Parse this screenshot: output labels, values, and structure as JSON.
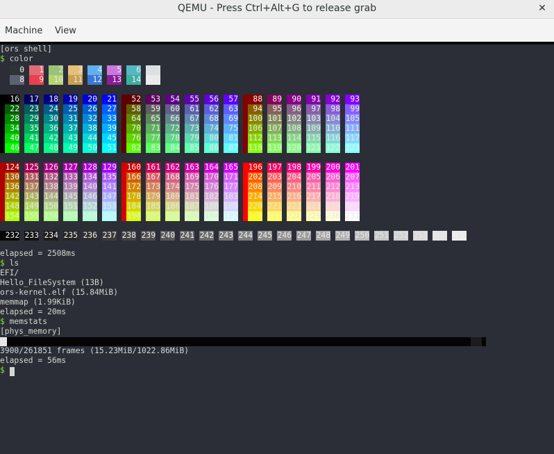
{
  "window": {
    "title": "QEMU - Press Ctrl+Alt+G to release grab",
    "close_glyph": "✕"
  },
  "menu": [
    "Machine",
    "View"
  ],
  "terminal": {
    "lines": [
      {
        "text": "[ors shell]"
      },
      {
        "prompt": "$",
        "text": " color"
      },
      {
        "text": ""
      },
      {
        "text": ""
      },
      {
        "text": ""
      },
      {
        "text": ""
      },
      {
        "text": ""
      },
      {
        "text": ""
      },
      {
        "text": ""
      },
      {
        "text": ""
      },
      {
        "text": ""
      },
      {
        "text": ""
      },
      {
        "text": ""
      },
      {
        "text": ""
      },
      {
        "text": ""
      },
      {
        "text": ""
      },
      {
        "text": ""
      },
      {
        "text": ""
      },
      {
        "text": ""
      },
      {
        "text": ""
      },
      {
        "text": ""
      },
      {
        "text": "elapsed = 2508ms"
      },
      {
        "prompt": "$",
        "text": " ls"
      },
      {
        "text": "EFI/"
      },
      {
        "text": "Hello_FileSystem (13B)"
      },
      {
        "text": "ors-kernel.elf (15.84MiB)"
      },
      {
        "text": "memmap (1.99KiB)"
      },
      {
        "text": "elapsed = 20ms"
      },
      {
        "prompt": "$",
        "text": " memstats"
      },
      {
        "text": "[phys_memory]"
      },
      {
        "text": ""
      },
      {
        "text": "3900/261851 frames (15.23MiB/1022.86MiB)"
      },
      {
        "text": "elapsed = 56ms"
      },
      {
        "prompt": "$",
        "text": " "
      }
    ],
    "memory_bar_fraction": 0.0149,
    "ansi16": [
      "#2e3436",
      "#e06c75",
      "#98c379",
      "#e5c07b",
      "#61afef",
      "#c678dd",
      "#56b6c2",
      "#dcdfe4",
      "#5c6370",
      "#e84050",
      "#b5d46c",
      "#c7a050",
      "#3a78d6",
      "#8a1d9c",
      "#3bb0a0",
      "#ececec"
    ]
  }
}
